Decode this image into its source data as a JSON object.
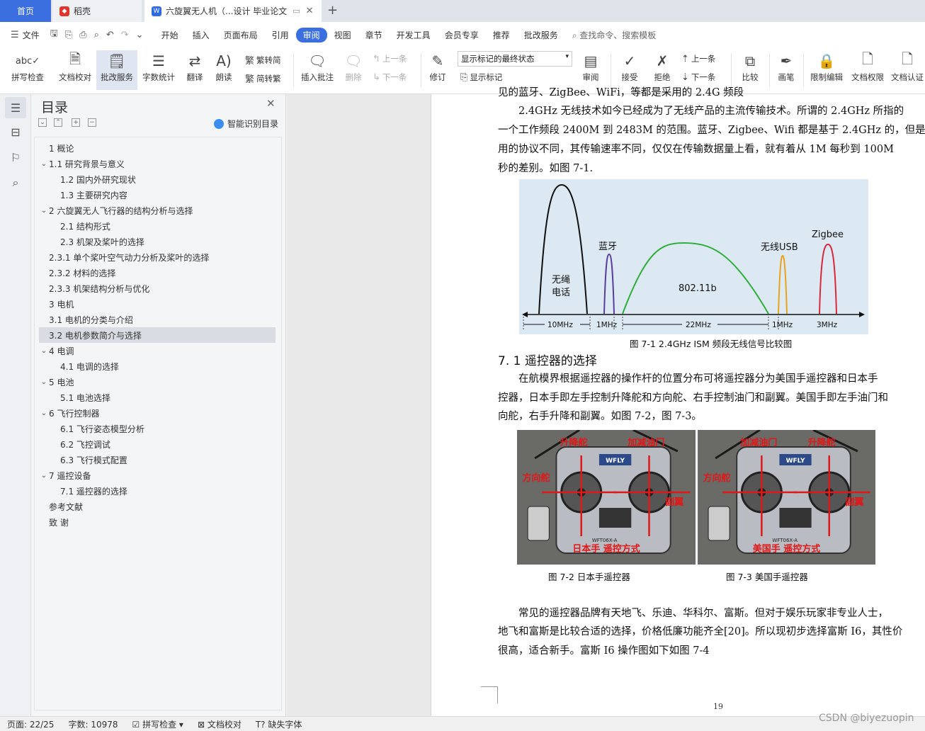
{
  "tabs": {
    "home": "首页",
    "daoke": "稻壳",
    "doc": "六旋翼无人机（...设计 毕业论文"
  },
  "menu": {
    "file": "文件",
    "items": [
      "开始",
      "插入",
      "页面布局",
      "引用",
      "审阅",
      "视图",
      "章节",
      "开发工具",
      "会员专享",
      "推荐",
      "批改服务"
    ],
    "search": "查找命令、搜索模板"
  },
  "ribbon": {
    "spell": "拼写检查",
    "proof": "文档校对",
    "review_service": "批改服务",
    "wordcount": "字数统计",
    "translate": "翻译",
    "read": "朗读",
    "to_trad": "繁转简",
    "to_simp": "简转繁",
    "insert_comment": "插入批注",
    "delete": "删除",
    "prev": "上一条",
    "next": "下一条",
    "revise": "修订",
    "mark_state": "显示标记的最终状态",
    "show_mark": "显示标记",
    "review": "审阅",
    "accept": "接受",
    "reject": "拒绝",
    "prev2": "上一条",
    "next2": "下一条",
    "compare": "比较",
    "pen": "画笔",
    "restrict": "限制编辑",
    "rights": "文档权限",
    "cert": "文档认证"
  },
  "toc": {
    "title": "目录",
    "ai": "智能识别目录",
    "items": [
      {
        "text": "1 概论",
        "level": 0,
        "chev": false
      },
      {
        "text": "1.1  研究背景与意义",
        "level": 0,
        "chev": true
      },
      {
        "text": "1.2  国内外研究现状",
        "level": 1,
        "chev": false
      },
      {
        "text": "1.3  主要研究内容",
        "level": 1,
        "chev": false
      },
      {
        "text": "2 六旋翼无人飞行器的结构分析与选择",
        "level": 0,
        "chev": true
      },
      {
        "text": "2.1 结构形式",
        "level": 1,
        "chev": false
      },
      {
        "text": "2.3 机架及桨叶的选择",
        "level": 1,
        "chev": false
      },
      {
        "text": "2.3.1  单个桨叶空气动力分析及桨叶的选择",
        "level": 0,
        "chev": false
      },
      {
        "text": "2.3.2 材料的选择",
        "level": 0,
        "chev": false
      },
      {
        "text": "2.3.3 机架结构分析与优化",
        "level": 0,
        "chev": false
      },
      {
        "text": "3 电机",
        "level": 0,
        "chev": false
      },
      {
        "text": "3.1 电机的分类与介绍",
        "level": 0,
        "chev": false
      },
      {
        "text": "3.2 电机参数简介与选择",
        "level": 0,
        "chev": false
      },
      {
        "text": "4 电调",
        "level": 0,
        "chev": true
      },
      {
        "text": "4.1 电调的选择",
        "level": 1,
        "chev": false
      },
      {
        "text": "5 电池",
        "level": 0,
        "chev": true
      },
      {
        "text": "5.1 电池选择",
        "level": 1,
        "chev": false
      },
      {
        "text": "6 飞行控制器",
        "level": 0,
        "chev": true
      },
      {
        "text": "6.1 飞行姿态模型分析",
        "level": 1,
        "chev": false
      },
      {
        "text": "6.2 飞控调试",
        "level": 1,
        "chev": false
      },
      {
        "text": "6.3 飞行模式配置",
        "level": 1,
        "chev": false
      },
      {
        "text": "7 遥控设备",
        "level": 0,
        "chev": true
      },
      {
        "text": "7.1 遥控器的选择",
        "level": 1,
        "chev": false
      },
      {
        "text": "参考文献",
        "level": 0,
        "chev": false
      },
      {
        "text": "致   谢",
        "level": 0,
        "chev": false
      }
    ],
    "selected": 12
  },
  "doc": {
    "line0": "见的蓝牙、ZigBee、WiFi，等都是采用的 2.4G 频段",
    "para1": [
      "　　2.4GHz 无线技术如今已经成为了无线产品的主流传输技术。所谓的 2.4GHz 所指的",
      "一个工作频段 2400M 到 2483M 的范围。蓝牙、Zigbee、Wifi 都是基于 2.4GHz 的，但是",
      "用的协议不同，其传输速率不同，仅仅在传输数据量上看，就有着从 1M 每秒到 100M",
      "秒的差别。如图 7-1."
    ],
    "fig1_caption": "图 7-1   2.4GHz ISM 频段无线信号比较图",
    "section_title": "7. 1 遥控器的选择",
    "para2": [
      "　　在航模界根据遥控器的操作杆的位置分布可将遥控器分为美国手遥控器和日本手",
      "控器，日本手即左手控制升降舵和方向舵、右手控制油门和副翼。美国手即左手油门和",
      "向舵，右手升降和副翼。如图 7-2，图 7-3。"
    ],
    "fig2_caption": "图 7-2 日本手遥控器",
    "fig3_caption": "图 7-3  美国手遥控器",
    "remote_left": {
      "top_l": "升降舵",
      "top_r": "加减油门",
      "mid_l": "方向舵",
      "mid_r": "副翼",
      "bottom": "日本手  遥控方式",
      "brand": "WFLY",
      "model": "WFT06X-A"
    },
    "remote_right": {
      "top_l": "加减油门",
      "top_r": "升降舵",
      "mid_l": "方向舵",
      "mid_r": "副翼",
      "bottom": "美国手  遥控方式",
      "brand": "WFLY",
      "model": "WFT06X-A"
    },
    "para3": [
      "　　常见的遥控器品牌有天地飞、乐迪、华科尔、富斯。但对于娱乐玩家非专业人士，",
      "地飞和富斯是比较合适的选择，价格低廉功能齐全[20]。所以现初步选择富斯 I6，其性价",
      "很高，适合新手。富斯 I6 操作图如下如图 7-4"
    ],
    "page_number": "19"
  },
  "chart_data": {
    "type": "area",
    "labels": {
      "cordless": [
        "无绳",
        "电话"
      ],
      "bluetooth": "蓝牙",
      "wifi": "802.11b",
      "wusb": "无线USB",
      "zigbee": "Zigbee"
    },
    "bandwidths": [
      "10MHz",
      "1MHz",
      "22MHz",
      "1MHz",
      "3MHz"
    ],
    "colors": {
      "cordless": "#111111",
      "bluetooth": "#5a3e9e",
      "wifi": "#2fae3a",
      "wusb": "#e9a21b",
      "zigbee": "#d8283a"
    }
  },
  "status": {
    "page": "页面: 22/25",
    "words": "字数: 10978",
    "spell": "拼写检查",
    "proof": "文档校对",
    "font": "缺失字体"
  },
  "watermark": "CSDN @biyezuopin"
}
